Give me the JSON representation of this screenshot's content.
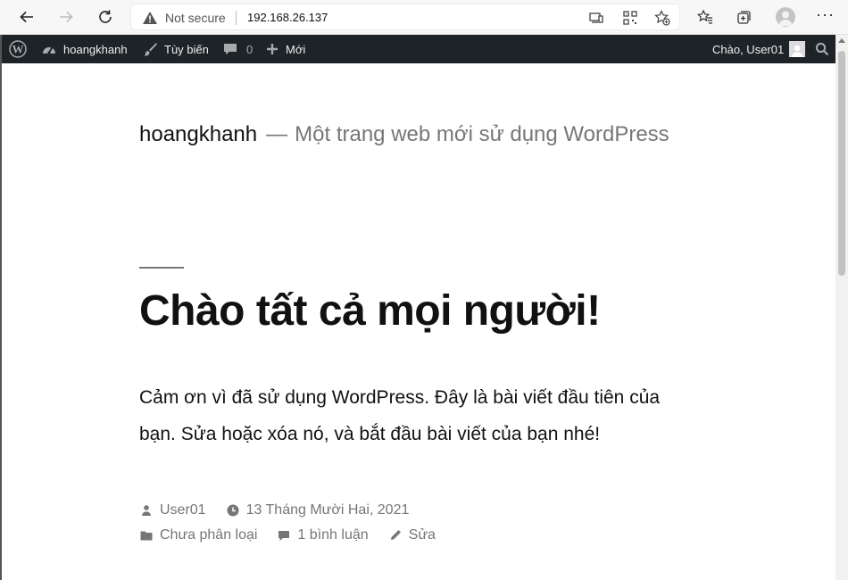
{
  "browser": {
    "security_label": "Not secure",
    "url": "192.168.26.137",
    "icons": [
      "back-icon",
      "forward-icon",
      "reload-icon",
      "warning-icon",
      "app-available-icon",
      "qr-code-icon",
      "add-favorite-icon",
      "favorites-icon",
      "collections-icon",
      "profile-icon",
      "more-icon"
    ]
  },
  "adminbar": {
    "site_name": "hoangkhanh",
    "customize": "Tùy biến",
    "comments_count": "0",
    "new": "Mới",
    "greeting": "Chào, User01",
    "colors": {
      "background": "#1d2327",
      "text": "#f0f0f1"
    }
  },
  "site": {
    "title": "hoangkhanh",
    "separator": "—",
    "description": "Một trang web mới sử dụng WordPress"
  },
  "post": {
    "title": "Chào tất cả mọi người!",
    "content": "Cảm ơn vì đã sử dụng WordPress. Đây là bài viết đầu tiên của bạn. Sửa hoặc xóa nó, và bắt đầu bài viết của bạn nhé!",
    "meta": {
      "author": "User01",
      "date": "13 Tháng Mười Hai, 2021",
      "category": "Chưa phân loại",
      "comments": "1 bình luận",
      "edit": "Sửa"
    }
  }
}
